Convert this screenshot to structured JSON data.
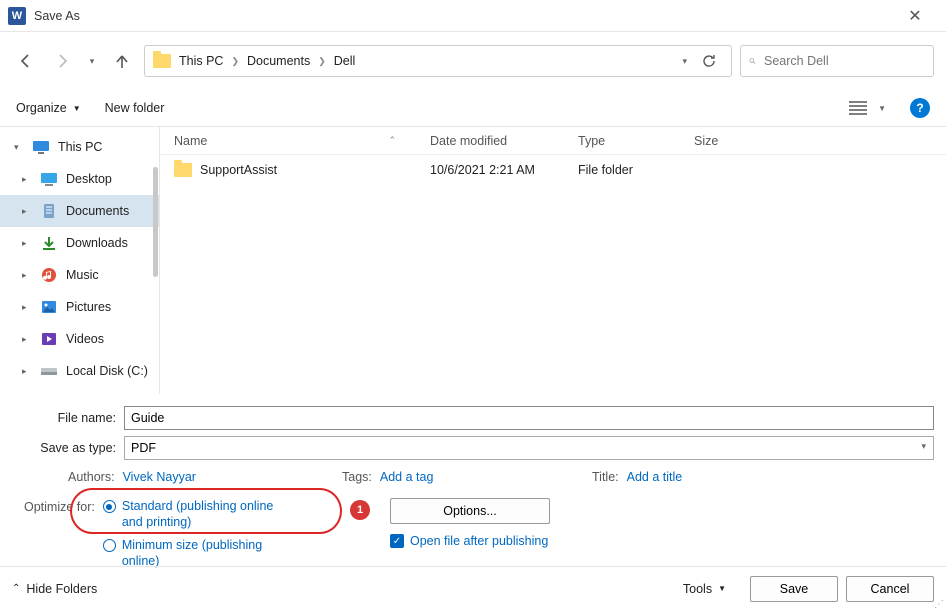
{
  "window": {
    "title": "Save As"
  },
  "breadcrumb": {
    "items": [
      "This PC",
      "Documents",
      "Dell"
    ]
  },
  "search": {
    "placeholder": "Search Dell"
  },
  "toolbar": {
    "organize": "Organize",
    "new_folder": "New folder"
  },
  "sidebar": {
    "items": [
      {
        "label": "This PC"
      },
      {
        "label": "Desktop"
      },
      {
        "label": "Documents"
      },
      {
        "label": "Downloads"
      },
      {
        "label": "Music"
      },
      {
        "label": "Pictures"
      },
      {
        "label": "Videos"
      },
      {
        "label": "Local Disk (C:)"
      }
    ]
  },
  "columns": {
    "name": "Name",
    "date": "Date modified",
    "type": "Type",
    "size": "Size"
  },
  "files": [
    {
      "name": "SupportAssist",
      "date": "10/6/2021 2:21 AM",
      "type": "File folder",
      "size": ""
    }
  ],
  "fields": {
    "file_name_label": "File name:",
    "file_name_value": "Guide",
    "save_type_label": "Save as type:",
    "save_type_value": "PDF"
  },
  "meta": {
    "authors_label": "Authors:",
    "authors_value": "Vivek Nayyar",
    "tags_label": "Tags:",
    "tags_value": "Add a tag",
    "title_label": "Title:",
    "title_value": "Add a title"
  },
  "optimize": {
    "label": "Optimize for:",
    "standard": "Standard (publishing online and printing)",
    "minimum": "Minimum size (publishing online)",
    "options_btn": "Options...",
    "open_after": "Open file after publishing",
    "annotation_number": "1"
  },
  "footer": {
    "hide_folders": "Hide Folders",
    "tools": "Tools",
    "save": "Save",
    "cancel": "Cancel"
  }
}
